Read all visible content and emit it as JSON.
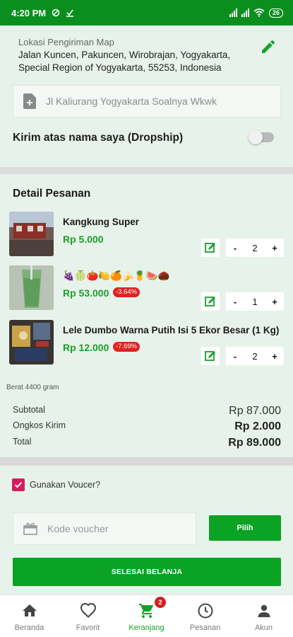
{
  "status_bar": {
    "time": "4:20 PM",
    "battery": "26"
  },
  "address": {
    "label": "Lokasi Pengiriman Map",
    "text": "Jalan Kuncen, Pakuncen, Wirobrajan, Yogyakarta, Special Region of Yogyakarta, 55253, Indonesia",
    "note_value": "Jl Kaliurang Yogyakarta Soalnya Wkwk"
  },
  "dropship": {
    "label": "Kirim atas nama saya (Dropship)",
    "enabled": false
  },
  "order": {
    "title": "Detail Pesanan",
    "items": [
      {
        "name": "Kangkung Super",
        "price": "Rp 5.000",
        "discount": "",
        "qty": "2"
      },
      {
        "name": "🍇🍈🍅🍋🍊🍌🍍🍉🌰",
        "price": "Rp 53.000",
        "discount": "-3.64%",
        "qty": "1"
      },
      {
        "name": "Lele Dumbo Warna Putih Isi 5 Ekor Besar (1 Kg)",
        "price": "Rp 12.000",
        "discount": "-7.69%",
        "qty": "2"
      }
    ],
    "qty_minus": "-",
    "qty_plus": "+",
    "weight": "Berat 4400 gram",
    "subtotal_label": "Subtotal",
    "subtotal": "Rp 87.000",
    "shipping_label": "Ongkos Kirim",
    "shipping": "Rp 2.000",
    "total_label": "Total",
    "total": "Rp 89.000"
  },
  "voucher": {
    "checkbox_label": "Gunakan Voucer?",
    "checked": true,
    "placeholder": "Kode voucher",
    "apply_label": "Pilih"
  },
  "finish_label": "SELESAI BELANJA",
  "nav": {
    "items": [
      {
        "label": "Beranda",
        "icon": "home-icon"
      },
      {
        "label": "Favorit",
        "icon": "heart-icon"
      },
      {
        "label": "Keranjang",
        "icon": "cart-icon",
        "badge": "2",
        "active": true
      },
      {
        "label": "Pesanan",
        "icon": "clock-icon"
      },
      {
        "label": "Akun",
        "icon": "person-icon"
      }
    ]
  },
  "colors": {
    "primary": "#0aa324",
    "status_bar": "#0a8f1f",
    "price": "#1aa128",
    "discount": "#e02222",
    "checkbox": "#d81b60"
  }
}
